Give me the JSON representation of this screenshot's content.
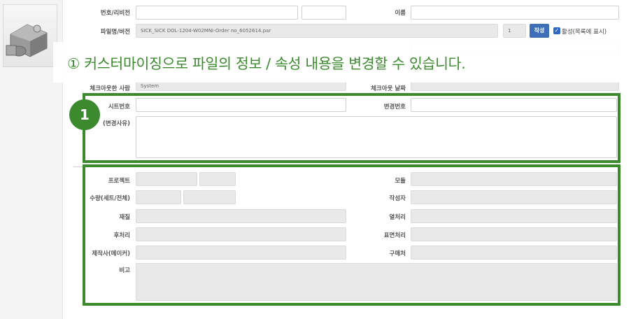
{
  "form": {
    "number_revision_label": "번호/리비전",
    "name_label": "이름",
    "file_version_label": "파일명/버전",
    "file_name_value": "SICK_SICK DOL-1204-W02MNI-Order no_6052614.par",
    "version_value": "1",
    "create_button": "작성",
    "active_checkbox_label": "활성(목록에 표시)",
    "checked_out_by_label": "체크아웃한 사람",
    "checked_out_by_value": "System",
    "checkout_date_label": "체크아웃 날짜",
    "sheet_number_label": "시트번호",
    "change_number_label": "변경번호",
    "change_reason_label": "(변경사유)",
    "project_label": "프로젝트",
    "model_label": "모듈",
    "quantity_label": "수량(세트/전체)",
    "author_label": "작성자",
    "material_label": "재질",
    "heat_treatment_label": "열처리",
    "post_process_label": "후처리",
    "surface_treatment_label": "표면처리",
    "manufacturer_label": "제작사(메이커)",
    "vendor_label": "구매처",
    "remarks_label": "비고"
  },
  "annotation": {
    "banner_text": "① 커스터마이징으로 파일의 정보 / 속성 내용을 변경할 수 있습니다.",
    "badge_number": "1",
    "highlight_color": "#3b8a2d"
  },
  "icons": {
    "thumbnail": "connector-part-thumbnail",
    "checkbox": "checkbox-checked-icon"
  }
}
